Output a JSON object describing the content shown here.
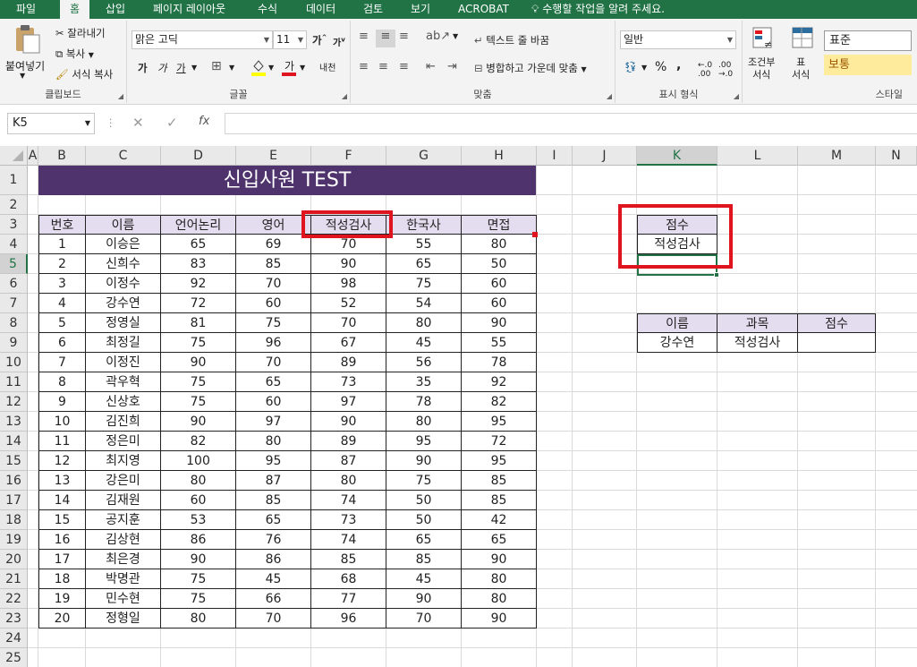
{
  "tabs": [
    {
      "label": "파일",
      "active": false
    },
    {
      "label": "홈",
      "active": true
    },
    {
      "label": "삽입",
      "active": false
    },
    {
      "label": "페이지 레이아웃",
      "active": false
    },
    {
      "label": "수식",
      "active": false
    },
    {
      "label": "데이터",
      "active": false
    },
    {
      "label": "검토",
      "active": false
    },
    {
      "label": "보기",
      "active": false
    },
    {
      "label": "ACROBAT",
      "active": false
    }
  ],
  "tell_me": "수행할 작업을 알려 주세요.",
  "ribbon": {
    "clipboard": {
      "paste": "붙여넣기",
      "cut": "잘라내기",
      "copy": "복사",
      "format_painter": "서식 복사",
      "name": "클립보드"
    },
    "font": {
      "face": "맑은 고딕",
      "size": "11",
      "name": "글꼴",
      "bold": "가",
      "italic": "가",
      "underline": "가",
      "grow": "가",
      "shrink": "가",
      "phonetic": "내천"
    },
    "align": {
      "wrap": "텍스트 줄 바꿈",
      "merge": "병합하고 가운데 맞춤",
      "name": "맞춤"
    },
    "number": {
      "format": "일반",
      "percent": "%",
      "comma": ",",
      "name": "표시 형식"
    },
    "styles": {
      "conditional": "조건부\n서식",
      "table": "표\n서식",
      "normal": "표준",
      "neutral": "보통",
      "name": "스타일"
    }
  },
  "formula_bar": {
    "cell_ref": "K5",
    "value": "",
    "fx": "fx"
  },
  "columns": [
    "A",
    "B",
    "C",
    "D",
    "E",
    "F",
    "G",
    "H",
    "I",
    "J",
    "K",
    "L",
    "M",
    "N"
  ],
  "rows": [
    "1",
    "2",
    "3",
    "4",
    "5",
    "6",
    "7",
    "8",
    "9",
    "10",
    "11",
    "12",
    "13",
    "14",
    "15",
    "16",
    "17",
    "18",
    "19",
    "20",
    "21",
    "22",
    "23",
    "24",
    "25"
  ],
  "selected_col": "K",
  "selected_row": "5",
  "sheet_title": "신입사원 TEST",
  "table_headers": [
    "번호",
    "이름",
    "언어논리",
    "영어",
    "적성검사",
    "한국사",
    "면접"
  ],
  "table_rows": [
    [
      "1",
      "이승은",
      "65",
      "69",
      "70",
      "55",
      "80"
    ],
    [
      "2",
      "신희수",
      "83",
      "85",
      "90",
      "65",
      "50"
    ],
    [
      "3",
      "이정수",
      "92",
      "70",
      "98",
      "75",
      "60"
    ],
    [
      "4",
      "강수연",
      "72",
      "60",
      "52",
      "54",
      "60"
    ],
    [
      "5",
      "정영실",
      "81",
      "75",
      "70",
      "80",
      "90"
    ],
    [
      "6",
      "최정길",
      "75",
      "96",
      "67",
      "45",
      "55"
    ],
    [
      "7",
      "이정진",
      "90",
      "70",
      "89",
      "56",
      "78"
    ],
    [
      "8",
      "곽우혁",
      "75",
      "65",
      "73",
      "35",
      "92"
    ],
    [
      "9",
      "신상호",
      "75",
      "60",
      "97",
      "78",
      "82"
    ],
    [
      "10",
      "김진희",
      "90",
      "97",
      "90",
      "80",
      "95"
    ],
    [
      "11",
      "정은미",
      "82",
      "80",
      "89",
      "95",
      "72"
    ],
    [
      "12",
      "최지영",
      "100",
      "95",
      "87",
      "90",
      "95"
    ],
    [
      "13",
      "강은미",
      "80",
      "87",
      "80",
      "75",
      "85"
    ],
    [
      "14",
      "김재원",
      "60",
      "85",
      "74",
      "50",
      "85"
    ],
    [
      "15",
      "공지훈",
      "53",
      "65",
      "73",
      "50",
      "42"
    ],
    [
      "16",
      "김상현",
      "86",
      "76",
      "74",
      "65",
      "65"
    ],
    [
      "17",
      "최은경",
      "90",
      "86",
      "85",
      "85",
      "90"
    ],
    [
      "18",
      "박명관",
      "75",
      "45",
      "68",
      "45",
      "80"
    ],
    [
      "19",
      "민수현",
      "75",
      "66",
      "77",
      "90",
      "80"
    ],
    [
      "20",
      "정형일",
      "80",
      "70",
      "96",
      "70",
      "90"
    ]
  ],
  "criteria": {
    "header": "점수",
    "value": "적성검사"
  },
  "lookup": {
    "headers": [
      "이름",
      "과목",
      "점수"
    ],
    "values": [
      "강수연",
      "적성검사",
      ""
    ]
  },
  "colors": {
    "accent": "#217346",
    "title_bg": "#4f336c",
    "header_bg": "#e4dcef",
    "highlight": "#e0141e"
  }
}
